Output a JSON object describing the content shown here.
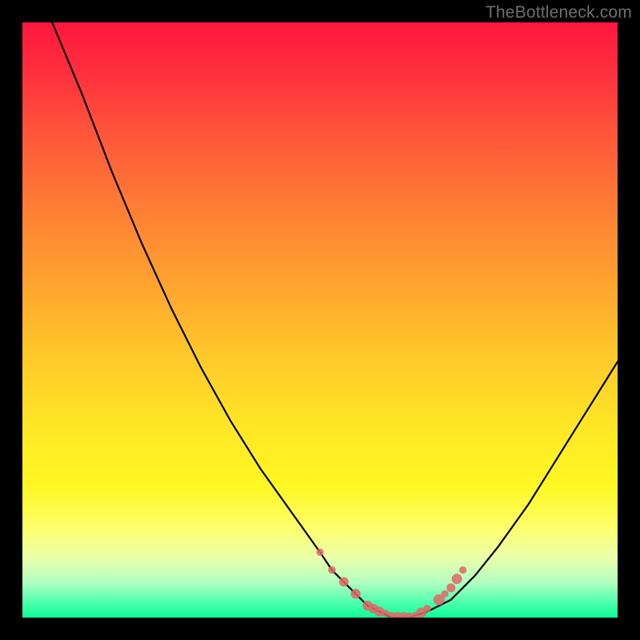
{
  "watermark": "TheBottleneck.com",
  "colors": {
    "frame": "#000000",
    "curve": "#000000",
    "dots": "#e06666",
    "gradient_top": "#ff173f",
    "gradient_bottom": "#0aff98"
  },
  "chart_data": {
    "type": "line",
    "title": "",
    "xlabel": "",
    "ylabel": "",
    "xlim": [
      0,
      100
    ],
    "ylim": [
      0,
      100
    ],
    "grid": false,
    "legend": false,
    "annotations": [
      "TheBottleneck.com"
    ],
    "series": [
      {
        "name": "bottleneck-curve",
        "x": [
          5,
          10,
          15,
          20,
          25,
          30,
          35,
          40,
          45,
          50,
          52,
          55,
          58,
          60,
          62,
          65,
          68,
          72,
          76,
          80,
          85,
          90,
          95,
          100
        ],
        "y": [
          100,
          88,
          75,
          63,
          52,
          42,
          33,
          25,
          18,
          11,
          8,
          5,
          2,
          1,
          0,
          0,
          1,
          3,
          7,
          12,
          19,
          27,
          35,
          43
        ]
      }
    ],
    "highlight_points": {
      "name": "sweet-spot-dots",
      "x": [
        50,
        52,
        54,
        56,
        58,
        59,
        60,
        61,
        62,
        63,
        64,
        65,
        66,
        67,
        68,
        70,
        71,
        72,
        73,
        74
      ],
      "y": [
        11,
        8,
        6,
        4,
        2,
        1.5,
        1,
        0.7,
        0.4,
        0.3,
        0.2,
        0.2,
        0.4,
        0.8,
        1.5,
        3,
        4,
        5,
        6.5,
        8
      ]
    }
  }
}
